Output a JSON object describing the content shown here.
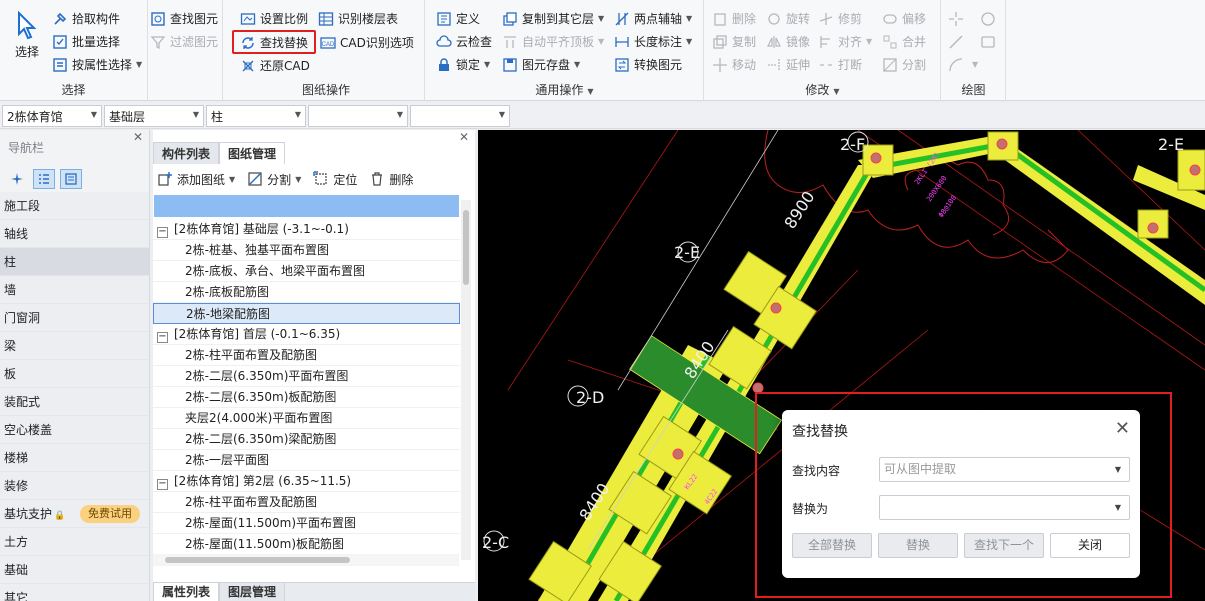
{
  "ribbon": {
    "select_group": {
      "big_label": "选择",
      "pick": "拾取构件",
      "batch": "批量选择",
      "by_attr": "按属性选择",
      "find_elem": "查找图元",
      "filter_elem": "过滤图元",
      "title": "选择"
    },
    "drawing_group": {
      "set_scale": "设置比例",
      "recognize_floor": "识别楼层表",
      "find_replace": "查找替换",
      "cad_options": "CAD识别选项",
      "restore_cad": "还原CAD",
      "title": "图纸操作"
    },
    "common_group": {
      "define": "定义",
      "copy_to_floor": "复制到其它层",
      "two_point_axis": "两点辅轴",
      "cloud_check": "云检查",
      "auto_align": "自动平齐顶板",
      "length_mark": "长度标注",
      "lock": "锁定",
      "save_elem": "图元存盘",
      "convert_elem": "转换图元",
      "title": "通用操作"
    },
    "modify_group": {
      "delete": "删除",
      "rotate": "旋转",
      "trim": "修剪",
      "offset": "偏移",
      "copy": "复制",
      "mirror": "镜像",
      "align": "对齐",
      "merge": "合并",
      "move": "移动",
      "extend": "延伸",
      "break": "打断",
      "split": "分割",
      "title": "修改"
    },
    "draw_group": {
      "title": "绘图"
    }
  },
  "toolbar": {
    "building": "2栋体育馆",
    "floor": "基础层",
    "element": "柱",
    "combo4": "",
    "combo5": ""
  },
  "nav": {
    "title": "导航栏",
    "items": [
      "施工段",
      "轴线",
      "柱",
      "墙",
      "门窗洞",
      "梁",
      "板",
      "装配式",
      "空心楼盖",
      "楼梯",
      "装修",
      "基坑支护",
      "土方",
      "基础",
      "其它"
    ],
    "free_badge": "免费试用",
    "selected": "柱"
  },
  "drawing_panel": {
    "tab_components": "构件列表",
    "tab_drawings": "图纸管理",
    "add_drawing": "添加图纸",
    "split": "分割",
    "locate": "定位",
    "delete": "删除",
    "tree": [
      {
        "type": "grp",
        "label": "[2栋体育馆] 基础层 (-3.1~-0.1)"
      },
      {
        "type": "leaf",
        "label": "2栋-桩基、独基平面布置图"
      },
      {
        "type": "leaf",
        "label": "2栋-底板、承台、地梁平面布置图"
      },
      {
        "type": "leaf",
        "label": "2栋-底板配筋图"
      },
      {
        "type": "leaf",
        "label": "2栋-地梁配筋图",
        "selected": true
      },
      {
        "type": "grp",
        "label": "[2栋体育馆] 首层 (-0.1~6.35)"
      },
      {
        "type": "leaf",
        "label": "2栋-柱平面布置及配筋图"
      },
      {
        "type": "leaf",
        "label": "2栋-二层(6.350m)平面布置图"
      },
      {
        "type": "leaf",
        "label": "2栋-二层(6.350m)板配筋图"
      },
      {
        "type": "leaf",
        "label": "夹层2(4.000米)平面布置图"
      },
      {
        "type": "leaf",
        "label": "2栋-二层(6.350m)梁配筋图"
      },
      {
        "type": "leaf",
        "label": "2栋-一层平面图"
      },
      {
        "type": "grp",
        "label": "[2栋体育馆] 第2层 (6.35~11.5)"
      },
      {
        "type": "leaf",
        "label": "2栋-柱平面布置及配筋图"
      },
      {
        "type": "leaf",
        "label": "2栋-屋面(11.500m)平面布置图"
      },
      {
        "type": "leaf",
        "label": "2栋-屋面(11.500m)板配筋图"
      }
    ],
    "tab_properties": "属性列表",
    "tab_layers": "图层管理"
  },
  "cad": {
    "axis_labels": [
      "2-F",
      "2-E",
      "2-D",
      "2-C"
    ],
    "dimensions": [
      "8900",
      "8400",
      "8400"
    ]
  },
  "dialog": {
    "title": "查找替换",
    "find_label": "查找内容",
    "find_placeholder": "可从图中提取",
    "replace_label": "替换为",
    "replace_value": "",
    "btn_replace_all": "全部替换",
    "btn_replace": "替换",
    "btn_find_next": "查找下一个",
    "btn_close": "关闭"
  },
  "colors": {
    "highlight_red": "#e02020",
    "cad_yellow": "#ecec3c",
    "cad_green": "#25c025",
    "selection_blue": "#8cbcf2"
  }
}
